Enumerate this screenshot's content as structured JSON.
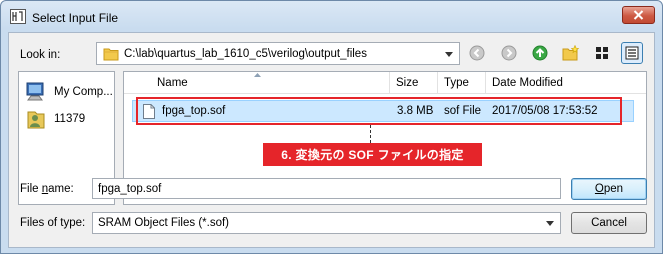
{
  "window": {
    "title": "Select Input File"
  },
  "look_in": {
    "label": "Look in:",
    "path": "C:\\lab\\quartus_lab_1610_c5\\verilog\\output_files"
  },
  "toolbar": {
    "icons": [
      "back-icon",
      "forward-icon",
      "up-folder-icon",
      "new-folder-icon",
      "list-view-icon",
      "detail-view-icon"
    ]
  },
  "sidebar": {
    "items": [
      {
        "label": "My Comp...",
        "icon": "computer-icon"
      },
      {
        "label": "11379",
        "icon": "user-folder-icon"
      }
    ]
  },
  "file_list": {
    "columns": [
      "Name",
      "Size",
      "Type",
      "Date Modified"
    ],
    "rows": [
      {
        "name": "fpga_top.sof",
        "size": "3.8 MB",
        "type": "sof File",
        "date": "2017/05/08 17:53:52"
      }
    ]
  },
  "annotation": {
    "text": "6. 変換元の SOF ファイルの指定",
    "color": "#e5252a"
  },
  "file_name": {
    "label_pre": "File ",
    "label_ul": "n",
    "label_post": "ame:",
    "value": "fpga_top.sof"
  },
  "file_type": {
    "label": "Files of type:",
    "value": "SRAM Object Files (*.sof)"
  },
  "buttons": {
    "open_ul": "O",
    "open_rest": "pen",
    "cancel": "Cancel"
  }
}
